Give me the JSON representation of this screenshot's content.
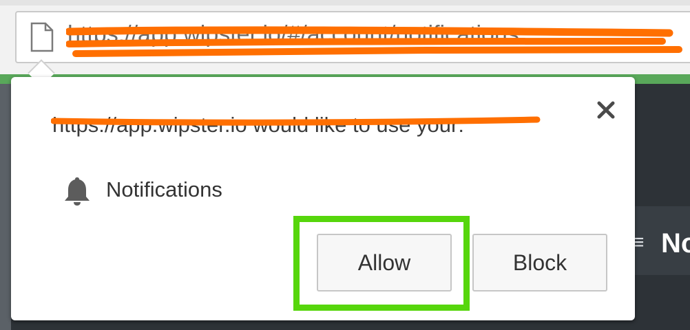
{
  "browser": {
    "address_bar": {
      "url": "https://app.wipster.io/#/account/notifications",
      "page_icon": "page-icon"
    }
  },
  "permission_popup": {
    "prompt": "https://app.wipster.io would like to use your:",
    "permission": {
      "icon": "bell-icon",
      "label": "Notifications"
    },
    "close_icon": "close-icon",
    "buttons": {
      "allow": "Allow",
      "block": "Block"
    }
  },
  "background_page": {
    "partial_heading": "No"
  },
  "colors": {
    "redaction": "#ff6f00",
    "highlight": "#56d60c",
    "chrome_accent": "#59a85a"
  }
}
